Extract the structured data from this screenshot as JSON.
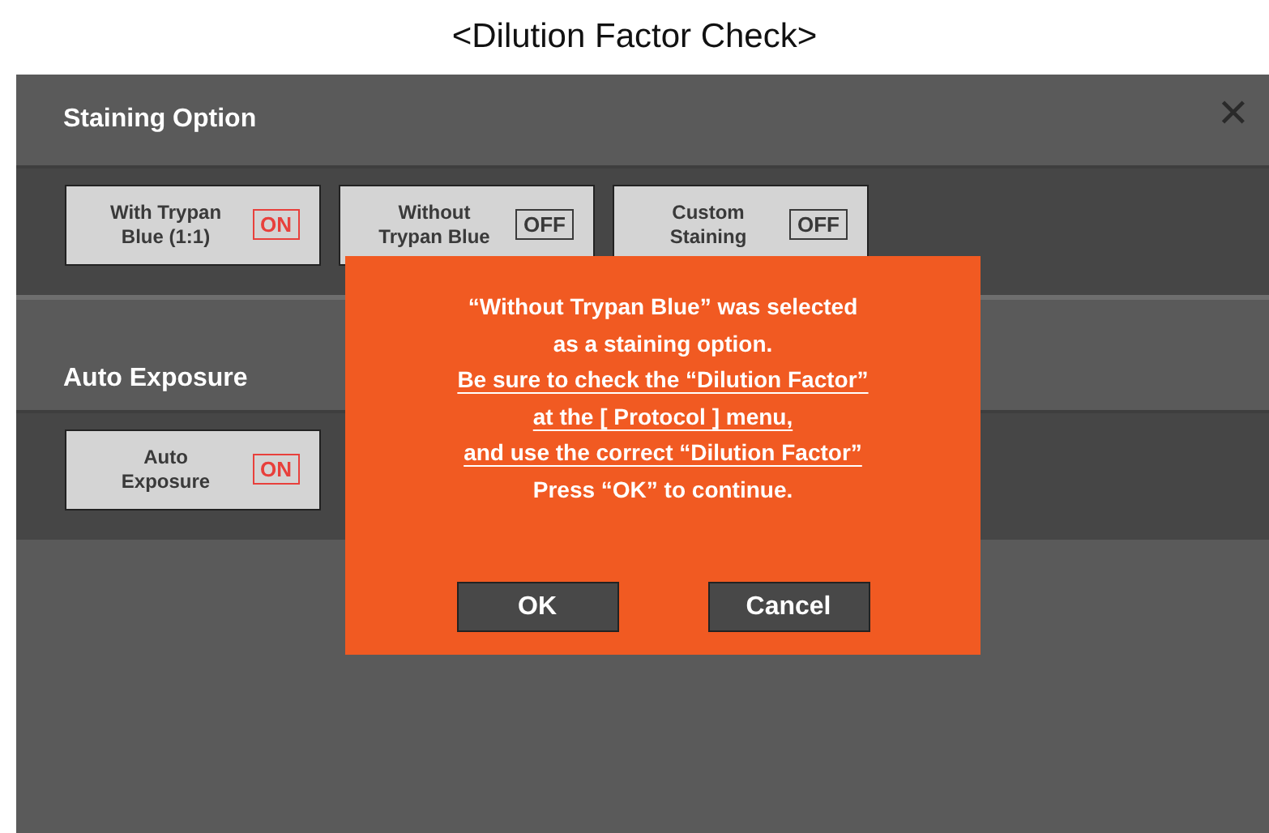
{
  "page_title": "<Dilution Factor Check>",
  "sections": [
    {
      "title": "Staining Option",
      "options": [
        {
          "label": "With Trypan Blue (1:1)",
          "on": true,
          "state_text": "ON"
        },
        {
          "label": "Without Trypan Blue",
          "on": false,
          "state_text": "OFF"
        },
        {
          "label": "Custom Staining",
          "on": false,
          "state_text": "OFF"
        }
      ]
    },
    {
      "title": "Auto Exposure",
      "options": [
        {
          "label": "Auto Exposure",
          "on": true,
          "state_text": "ON"
        }
      ]
    }
  ],
  "close_label": "✕",
  "dialog": {
    "lines": [
      {
        "text": "“Without Trypan Blue” was selected",
        "underlined": false
      },
      {
        "text": "as a staining option.",
        "underlined": false
      },
      {
        "text": "Be sure to check the “Dilution Factor”",
        "underlined": true
      },
      {
        "text": "at the [ Protocol ] menu,",
        "underlined": true
      },
      {
        "text": "and use the correct “Dilution Factor”",
        "underlined": true
      },
      {
        "text": "Press “OK” to continue.",
        "underlined": false
      }
    ],
    "buttons": [
      "OK",
      "Cancel"
    ]
  }
}
